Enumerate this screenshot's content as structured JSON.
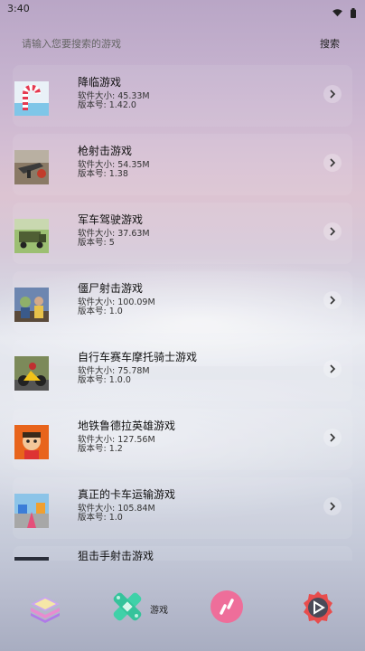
{
  "status_bar": {
    "time": "3:40"
  },
  "search": {
    "placeholder": "请输入您要搜索的游戏",
    "button_label": "搜索"
  },
  "games": [
    {
      "name": "降临游戏",
      "size_label": "软件大小:",
      "size": "45.33M",
      "version_label": "版本号:",
      "version": "1.42.0",
      "icon": "candy-cane-icon"
    },
    {
      "name": "枪射击游戏",
      "size_label": "软件大小:",
      "size": "54.35M",
      "version_label": "版本号:",
      "version": "1.38",
      "icon": "gun-icon"
    },
    {
      "name": "军车驾驶游戏",
      "size_label": "软件大小:",
      "size": "37.63M",
      "version_label": "版本号:",
      "version": "5",
      "icon": "army-truck-icon"
    },
    {
      "name": "僵尸射击游戏",
      "size_label": "软件大小:",
      "size": "100.09M",
      "version_label": "版本号:",
      "version": "1.0",
      "icon": "zombie-icon"
    },
    {
      "name": "自行车赛车摩托骑士游戏",
      "size_label": "软件大小:",
      "size": "75.78M",
      "version_label": "版本号:",
      "version": "1.0.0",
      "icon": "motorbike-icon"
    },
    {
      "name": "地铁鲁德拉英雄游戏",
      "size_label": "软件大小:",
      "size": "127.56M",
      "version_label": "版本号:",
      "version": "1.2",
      "icon": "hero-icon"
    },
    {
      "name": "真正的卡车运输游戏",
      "size_label": "软件大小:",
      "size": "105.84M",
      "version_label": "版本号:",
      "version": "1.0",
      "icon": "truck-icon"
    },
    {
      "name": "狙击手射击游戏",
      "icon": "sniper-icon"
    }
  ],
  "bottom_nav": {
    "items": [
      {
        "icon": "layers-icon"
      },
      {
        "icon": "bandage-icon",
        "label": "游戏"
      },
      {
        "icon": "link-icon"
      },
      {
        "icon": "play-gear-icon"
      }
    ]
  }
}
